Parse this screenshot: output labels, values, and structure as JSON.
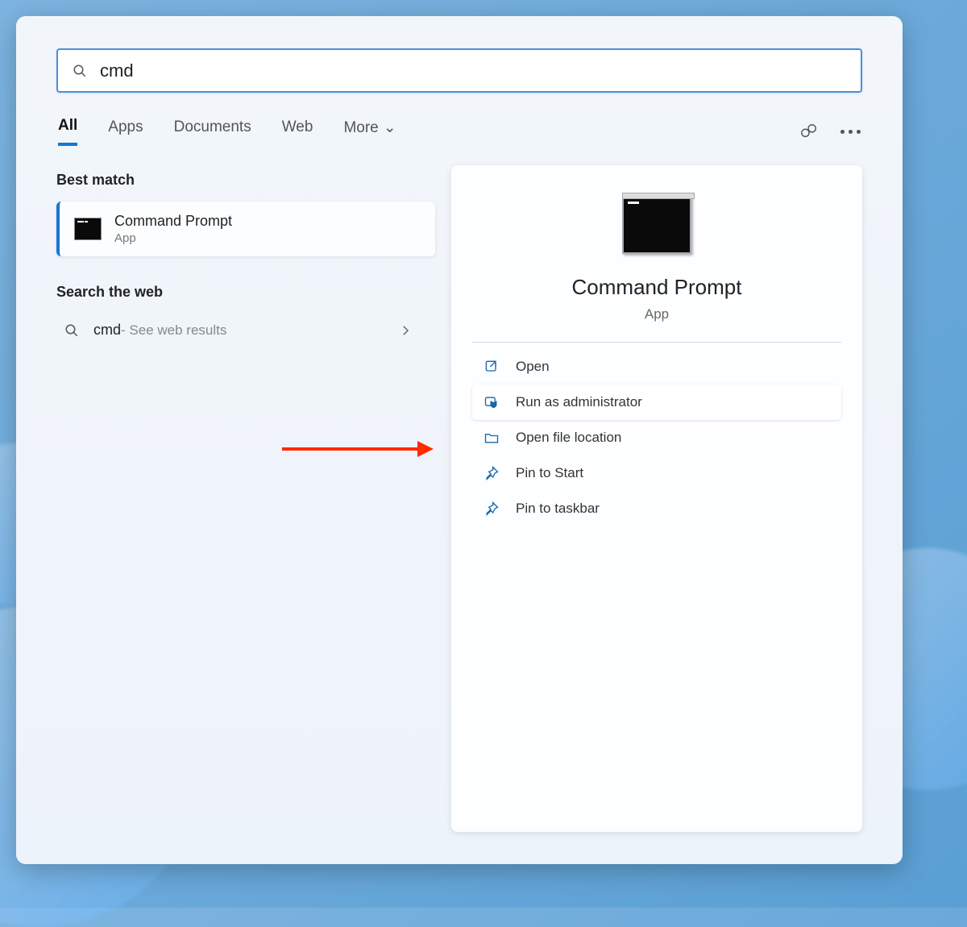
{
  "search": {
    "value": "cmd"
  },
  "tabs": [
    "All",
    "Apps",
    "Documents",
    "Web",
    "More"
  ],
  "sections": {
    "best_match": "Best match",
    "web": "Search the web"
  },
  "best_match": {
    "title": "Command Prompt",
    "subtitle": "App"
  },
  "web_result": {
    "query": "cmd",
    "suffix": " - See web results"
  },
  "preview": {
    "title": "Command Prompt",
    "subtitle": "App"
  },
  "actions": [
    {
      "label": "Open",
      "icon": "open",
      "highlight": false
    },
    {
      "label": "Run as administrator",
      "icon": "admin",
      "highlight": true
    },
    {
      "label": "Open file location",
      "icon": "folder",
      "highlight": false
    },
    {
      "label": "Pin to Start",
      "icon": "pin",
      "highlight": false
    },
    {
      "label": "Pin to taskbar",
      "icon": "pin",
      "highlight": false
    }
  ]
}
